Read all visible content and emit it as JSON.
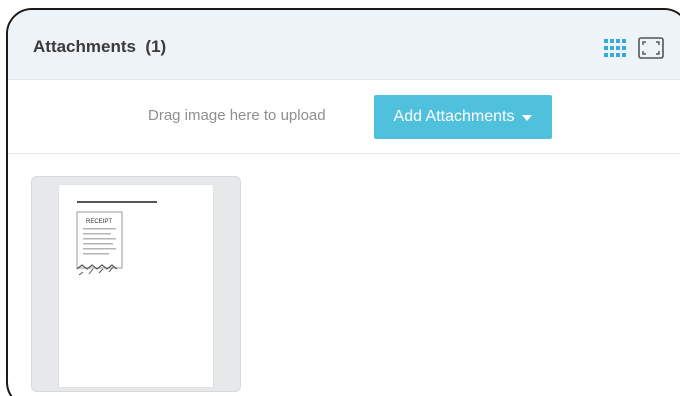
{
  "header": {
    "title": "Attachments",
    "count": "(1)",
    "grid_view_icon": "grid-view-icon",
    "expand_icon": "expand-icon",
    "accent_color": "#4fc1dd"
  },
  "upload": {
    "drag_text": "Drag image here to upload",
    "add_button_label": "Add Attachments",
    "dropdown_icon": "caret-down-icon"
  },
  "attachments": [
    {
      "type": "image",
      "thumbnail_heading": "RECEIPT"
    }
  ]
}
